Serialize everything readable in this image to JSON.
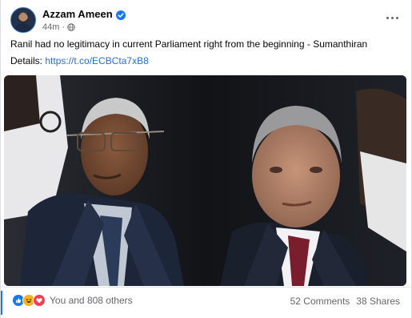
{
  "post": {
    "author": "Azzam Ameen",
    "timestamp": "44m",
    "audience_icon": "globe-icon",
    "verified_icon": "verified-badge-icon",
    "text": "Ranil had no legitimacy in current Parliament right from the beginning - Sumanthiran",
    "details_label": "Details:",
    "details_link": "https://t.co/ECBCta7xB8"
  },
  "footer": {
    "reaction_icons": [
      "like-icon",
      "haha-icon",
      "love-icon"
    ],
    "reaction_summary": "You and 808 others",
    "comments": "52 Comments",
    "shares": "38 Shares"
  },
  "colors": {
    "link": "#216fdb",
    "secondary_text": "#65676b",
    "like_blue": "#1877f2",
    "love_red": "#f33e58",
    "haha_yellow": "#f7b125"
  }
}
